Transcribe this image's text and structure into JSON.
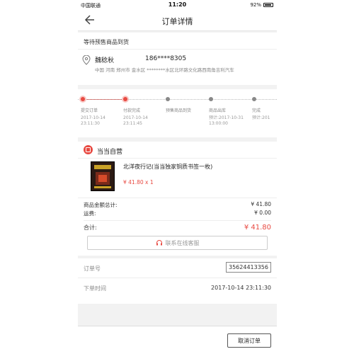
{
  "status_bar": {
    "carrier": "中国联通",
    "time": "11:20",
    "battery": "92%"
  },
  "navbar": {
    "title": "订单详情"
  },
  "order_status": "等待预售商品到货",
  "address": {
    "name": "魏稔秋",
    "phone": "186****8305",
    "detail": "中国  河南  郑州市  金水区  ********水区北环路文化路西南角吉利汽车"
  },
  "progress": [
    {
      "label": "提交订单",
      "time1": "2017-10-14",
      "time2": "23:11:30",
      "done": true
    },
    {
      "label": "付款完成",
      "time1": "2017-10-14",
      "time2": "23:11:45",
      "done": true
    },
    {
      "label": "预售商品到货",
      "time1": "",
      "time2": "",
      "done": false
    },
    {
      "label": "商品出库",
      "time1": "预计:2017-10-31",
      "time2": "13:00:00",
      "done": false
    },
    {
      "label": "完成",
      "time1": "预计:201",
      "time2": "",
      "done": false
    }
  ],
  "shop": {
    "name": "当当自营"
  },
  "product": {
    "name": "北洋夜行记(当当独家铜质书签一枚)",
    "price_qty": "¥ 41.80 x 1"
  },
  "summary": {
    "goods_label": "商品金额总计:",
    "goods_value": "¥ 41.80",
    "shipping_label": "运费:",
    "shipping_value": "¥ 0.00",
    "total_label": "合计:",
    "total_value": "¥ 41.80"
  },
  "service": {
    "label": "联系在线客服"
  },
  "meta": {
    "order_no_label": "订单号",
    "order_no": "35624413356",
    "order_time_label": "下单时间",
    "order_time": "2017-10-14 23:11:30"
  },
  "footer": {
    "cancel_label": "取消订单"
  },
  "colors": {
    "accent": "#e84a42"
  }
}
